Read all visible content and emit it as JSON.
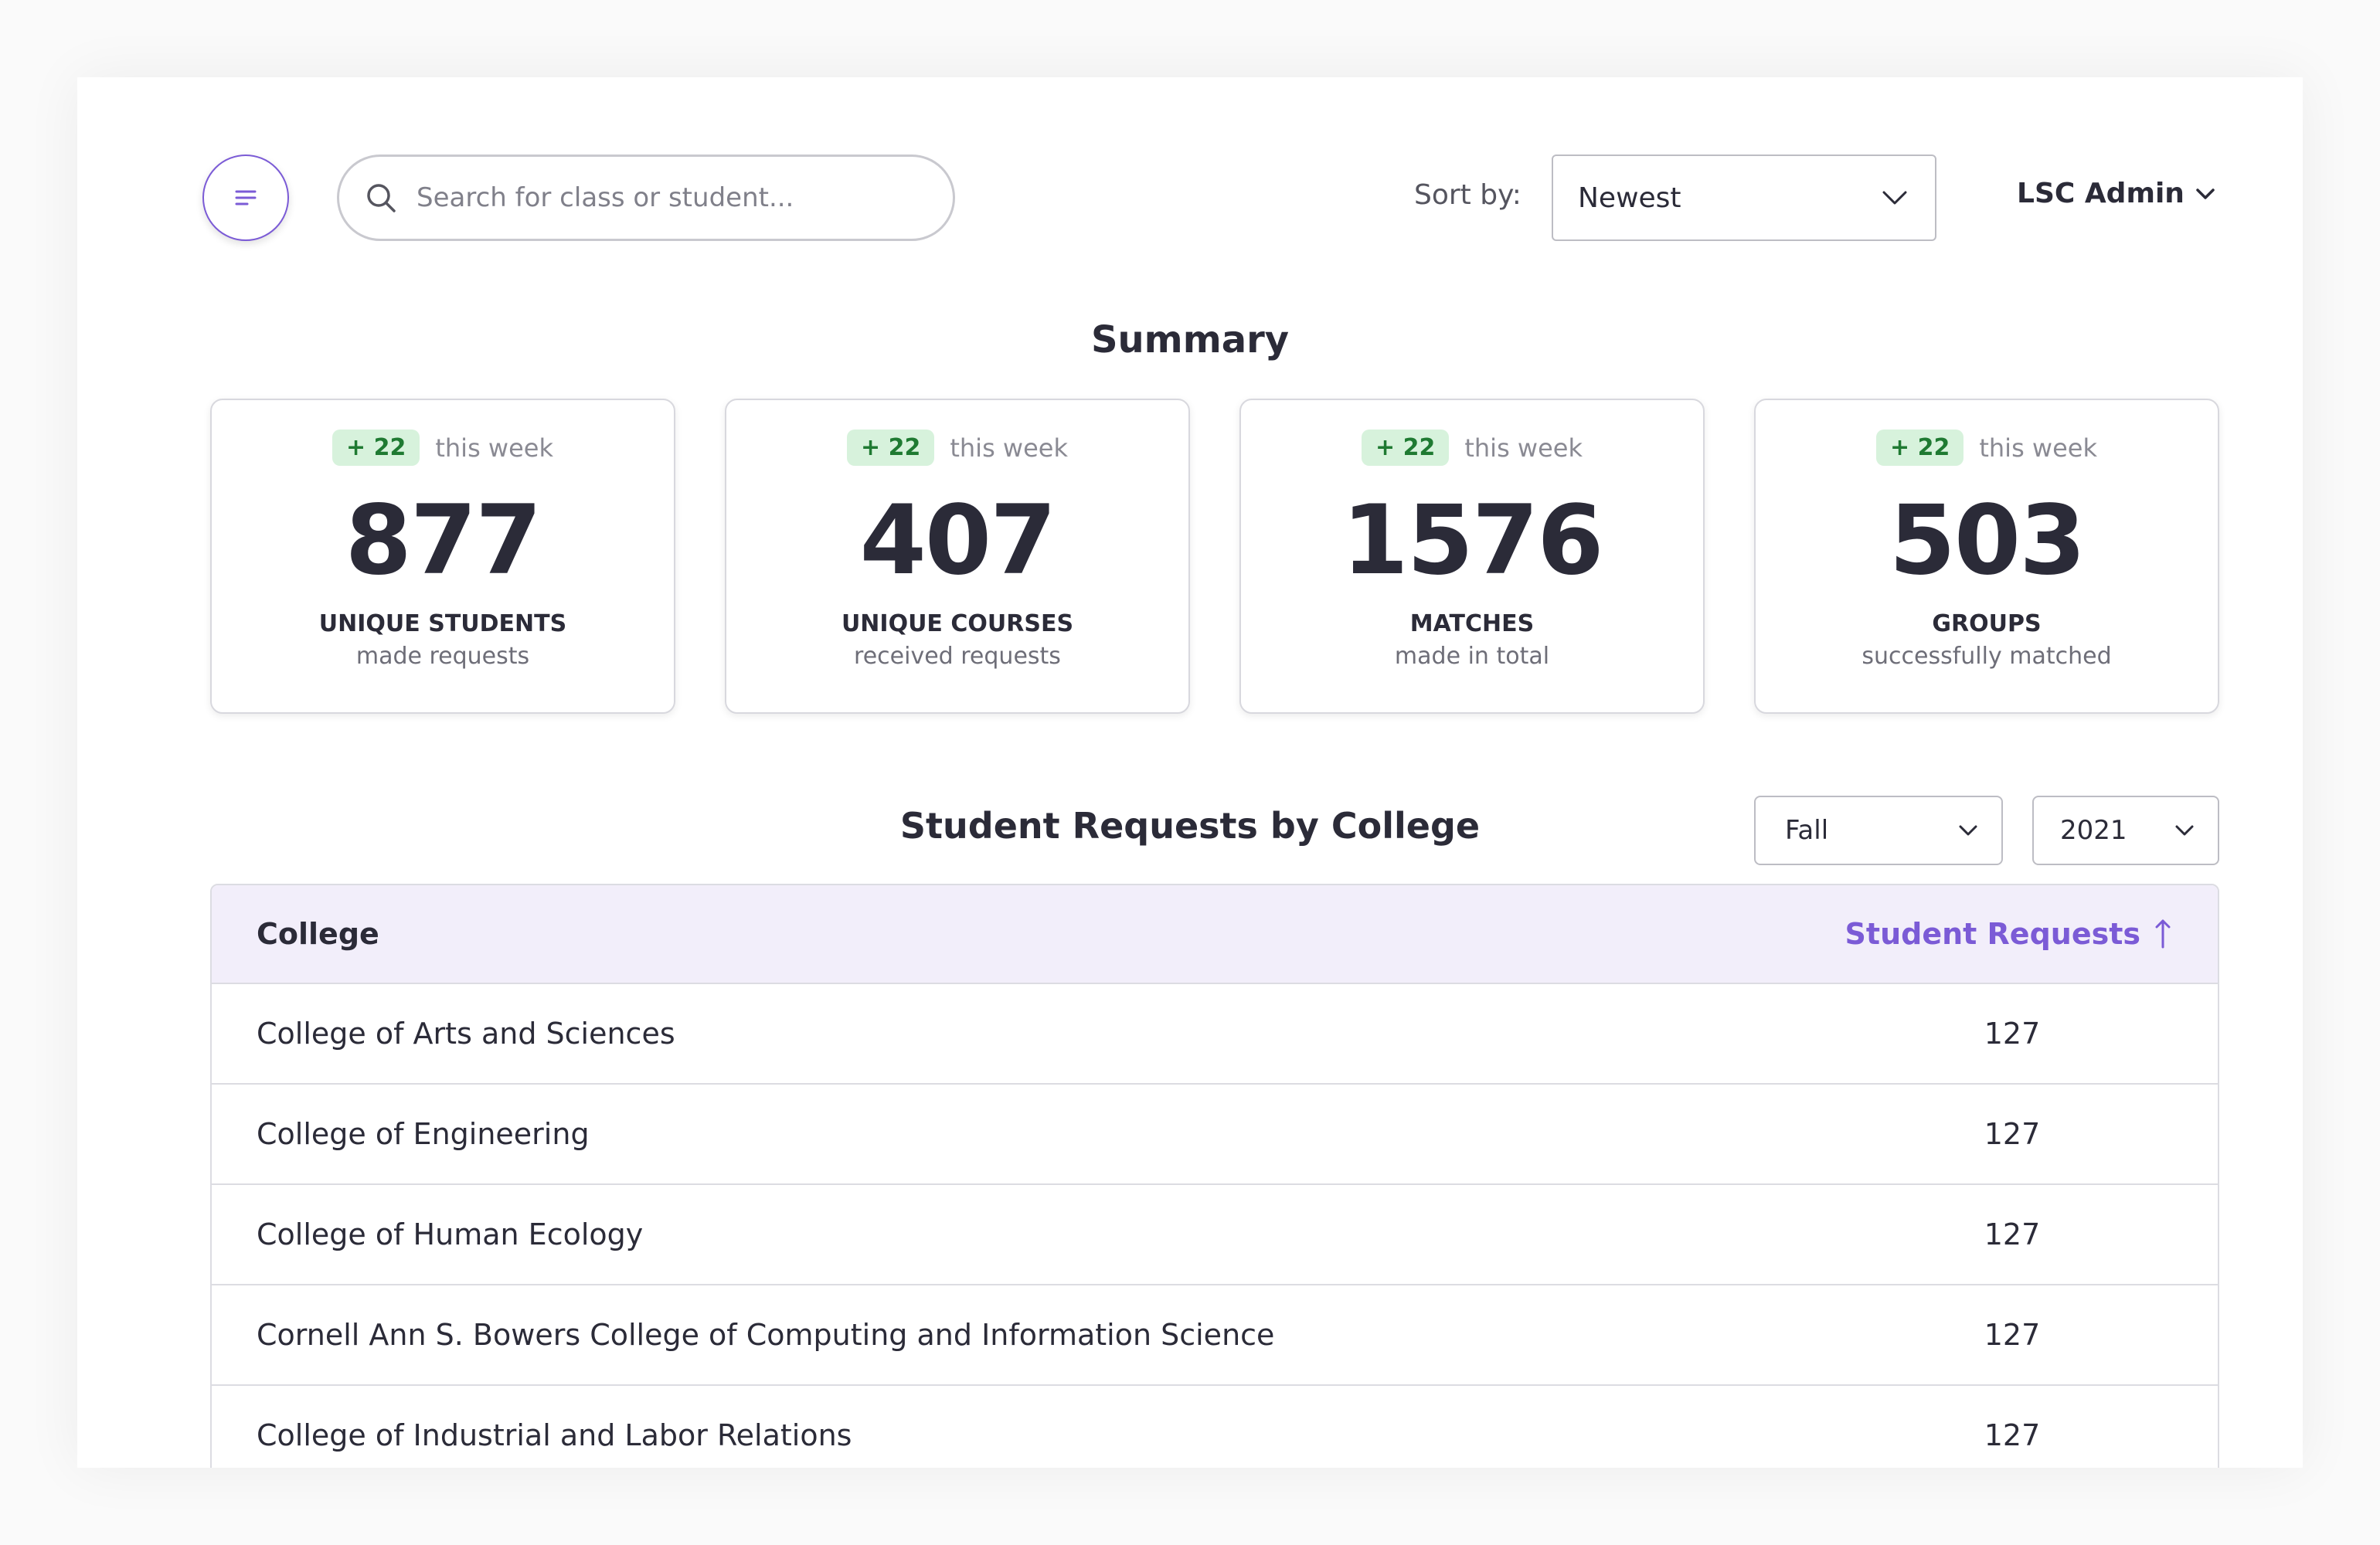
{
  "header": {
    "search_placeholder": "Search for class or student...",
    "sort_label": "Sort by:",
    "sort_value": "Newest",
    "user_menu": "LSC Admin"
  },
  "summary": {
    "title": "Summary",
    "cards": [
      {
        "delta": "+ 22",
        "period": "this week",
        "value": "877",
        "label": "UNIQUE STUDENTS",
        "sub": "made requests"
      },
      {
        "delta": "+ 22",
        "period": "this week",
        "value": "407",
        "label": "UNIQUE COURSES",
        "sub": "received requests"
      },
      {
        "delta": "+ 22",
        "period": "this week",
        "value": "1576",
        "label": "MATCHES",
        "sub": "made in total"
      },
      {
        "delta": "+ 22",
        "period": "this week",
        "value": "503",
        "label": "GROUPS",
        "sub": "successfully matched"
      }
    ]
  },
  "requests": {
    "title": "Student Requests by College",
    "term": "Fall",
    "year": "2021",
    "columns": {
      "college": "College",
      "requests": "Student Requests"
    },
    "rows": [
      {
        "college": "College of Arts and Sciences",
        "count": "127"
      },
      {
        "college": "College of Engineering",
        "count": "127"
      },
      {
        "college": "College of Human Ecology",
        "count": "127"
      },
      {
        "college": "Cornell Ann S. Bowers College of Computing and Information Science",
        "count": "127"
      },
      {
        "college": "College of Industrial and Labor Relations",
        "count": "127"
      }
    ]
  },
  "colors": {
    "accent": "#7b5bd6",
    "badge_bg": "#d7f2dc",
    "badge_text": "#1f7a32",
    "header_bg": "#f2eefa"
  }
}
